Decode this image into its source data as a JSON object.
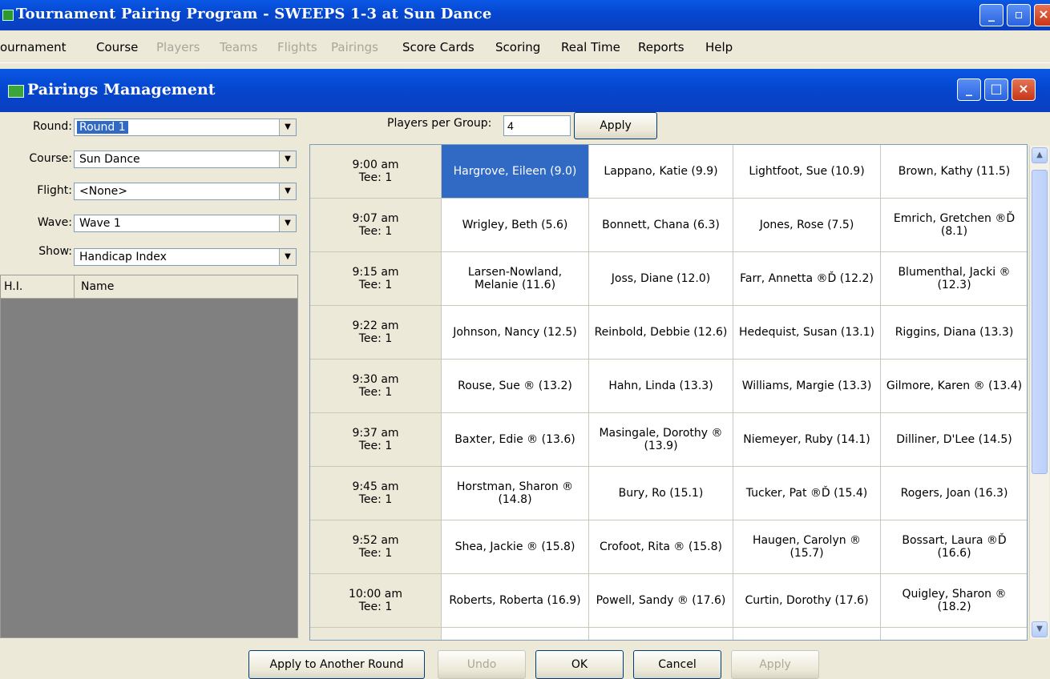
{
  "app_title": "Tournament Pairing Program - SWEEPS 1-3 at Sun Dance",
  "menu": [
    {
      "label": "ournament",
      "enabled": true
    },
    {
      "label": "Course",
      "enabled": true
    },
    {
      "label": "Players",
      "enabled": false
    },
    {
      "label": "Teams",
      "enabled": false
    },
    {
      "label": "Flights",
      "enabled": false
    },
    {
      "label": "Pairings",
      "enabled": false
    },
    {
      "label": "Score Cards",
      "enabled": true
    },
    {
      "label": "Scoring",
      "enabled": true
    },
    {
      "label": "Real Time",
      "enabled": true
    },
    {
      "label": "Reports",
      "enabled": true
    },
    {
      "label": "Help",
      "enabled": true
    }
  ],
  "dialog_title": "Pairings Management",
  "filters": {
    "round": {
      "label": "Round:",
      "value": "Round 1"
    },
    "course": {
      "label": "Course:",
      "value": "Sun Dance"
    },
    "flight": {
      "label": "Flight:",
      "value": "<None>"
    },
    "wave": {
      "label": "Wave:",
      "value": "Wave 1"
    },
    "show": {
      "label": "Show:",
      "value": "Handicap Index"
    }
  },
  "player_list": {
    "columns": [
      "H.I.",
      "Name"
    ]
  },
  "players_per_group": {
    "label": "Players per Group:",
    "value": "4",
    "apply_label": "Apply"
  },
  "pairings": [
    {
      "time": "9:00 am",
      "tee": "Tee: 1",
      "players": [
        "Hargrove, Eileen (9.0)",
        "Lappano, Katie (9.9)",
        "Lightfoot, Sue (10.9)",
        "Brown, Kathy (11.5)"
      ]
    },
    {
      "time": "9:07 am",
      "tee": "Tee: 1",
      "players": [
        "Wrigley, Beth (5.6)",
        "Bonnett, Chana (6.3)",
        "Jones, Rose (7.5)",
        "Emrich, Gretchen ®Ď (8.1)"
      ]
    },
    {
      "time": "9:15 am",
      "tee": "Tee: 1",
      "players": [
        "Larsen-Nowland, Melanie (11.6)",
        "Joss, Diane (12.0)",
        "Farr, Annetta ®Ď (12.2)",
        "Blumenthal, Jacki ® (12.3)"
      ]
    },
    {
      "time": "9:22 am",
      "tee": "Tee: 1",
      "players": [
        "Johnson, Nancy (12.5)",
        "Reinbold, Debbie (12.6)",
        "Hedequist, Susan (13.1)",
        "Riggins, Diana (13.3)"
      ]
    },
    {
      "time": "9:30 am",
      "tee": "Tee: 1",
      "players": [
        "Rouse, Sue ® (13.2)",
        "Hahn, Linda (13.3)",
        "Williams, Margie (13.3)",
        "Gilmore, Karen ® (13.4)"
      ]
    },
    {
      "time": "9:37 am",
      "tee": "Tee: 1",
      "players": [
        "Baxter, Edie ® (13.6)",
        "Masingale, Dorothy ® (13.9)",
        "Niemeyer, Ruby (14.1)",
        "Dilliner, D'Lee (14.5)"
      ]
    },
    {
      "time": "9:45 am",
      "tee": "Tee: 1",
      "players": [
        "Horstman, Sharon ® (14.8)",
        "Bury, Ro (15.1)",
        "Tucker, Pat ®Ď (15.4)",
        "Rogers, Joan (16.3)"
      ]
    },
    {
      "time": "9:52 am",
      "tee": "Tee: 1",
      "players": [
        "Shea, Jackie ® (15.8)",
        "Crofoot, Rita ® (15.8)",
        "Haugen, Carolyn ® (15.7)",
        "Bossart, Laura ®Ď (16.6)"
      ]
    },
    {
      "time": "10:00 am",
      "tee": "Tee: 1",
      "players": [
        "Roberts, Roberta (16.9)",
        "Powell, Sandy ® (17.6)",
        "Curtin, Dorothy (17.6)",
        "Quigley, Sharon ® (18.2)"
      ]
    }
  ],
  "buttons": {
    "apply_another": "Apply to Another Round",
    "undo": "Undo",
    "ok": "OK",
    "cancel": "Cancel",
    "apply": "Apply"
  },
  "colors": {
    "titlebar": "#0546cf",
    "selection": "#316ac5",
    "panel": "#ece9d8"
  }
}
